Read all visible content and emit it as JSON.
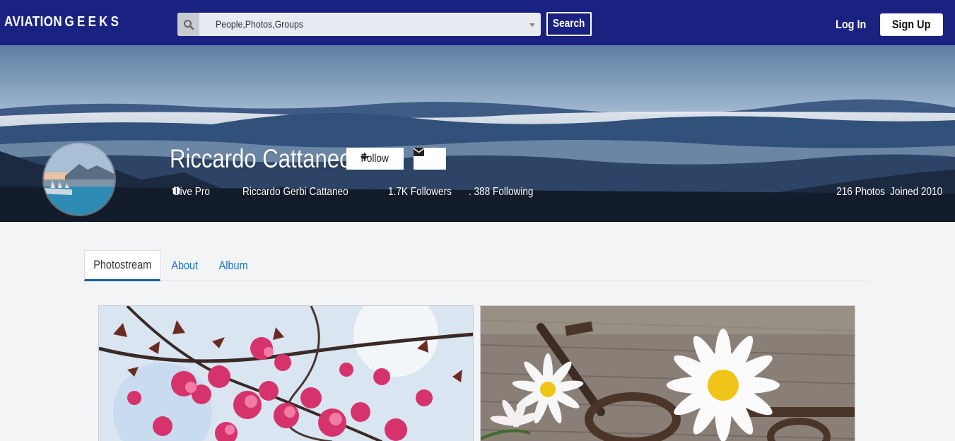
{
  "header": {
    "logo_part1": "AVIATION",
    "logo_part2": "GEEKS",
    "search_placeholder": "People,Photos,Groups",
    "search_button": "Search",
    "login": "Log In",
    "signup": "Sign Up"
  },
  "profile": {
    "name": "Riccardo Cattaneo",
    "follow_label": "Follow",
    "give_pro": "Give Pro",
    "full_name": "Riccardo Gerbi Cattaneo",
    "followers": "1.7K Followers",
    "following": ". 388 Following",
    "photos": "216 Photos",
    "joined": "Joined 2010"
  },
  "tabs": [
    {
      "label": "Photostream",
      "active": true
    },
    {
      "label": "About",
      "active": false
    },
    {
      "label": "Album",
      "active": false
    }
  ],
  "colors": {
    "header_bg": "#1a2281",
    "tab_active_border": "#1a5fa8",
    "tab_link": "#1a73c2"
  }
}
